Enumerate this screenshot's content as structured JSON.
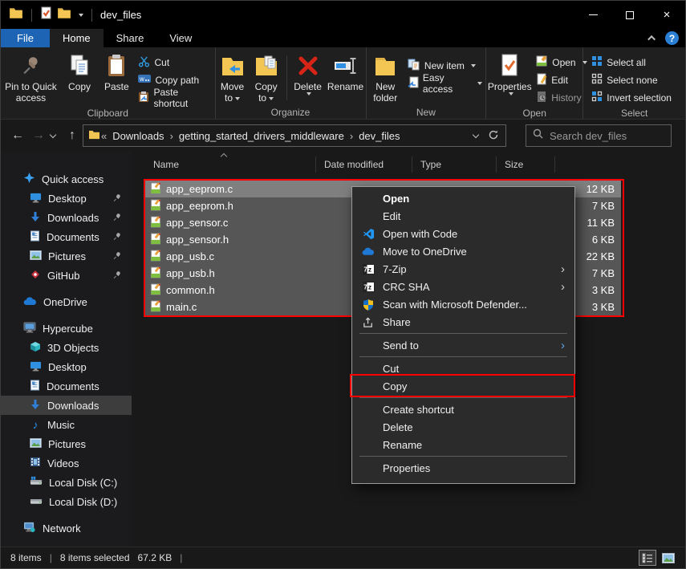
{
  "window": {
    "title": "dev_files"
  },
  "titlebar": {
    "minimize": "",
    "maximize": "",
    "close": "×",
    "help": "?"
  },
  "tabs": {
    "file": "File",
    "home": "Home",
    "share": "Share",
    "view": "View"
  },
  "ribbon": {
    "clipboard": {
      "label": "Clipboard",
      "pin_line1": "Pin to Quick",
      "pin_line2": "access",
      "copy": "Copy",
      "paste": "Paste",
      "cut": "Cut",
      "copy_path": "Copy path",
      "paste_shortcut": "Paste shortcut"
    },
    "organize": {
      "label": "Organize",
      "move_line1": "Move",
      "move_line2": "to",
      "copy_line1": "Copy",
      "copy_line2": "to",
      "delete": "Delete",
      "rename": "Rename"
    },
    "new": {
      "label": "New",
      "new_folder_line1": "New",
      "new_folder_line2": "folder",
      "new_item": "New item",
      "easy_access": "Easy access"
    },
    "open": {
      "label": "Open",
      "properties": "Properties",
      "open": "Open",
      "edit": "Edit",
      "history": "History"
    },
    "select": {
      "label": "Select",
      "select_all": "Select all",
      "select_none": "Select none",
      "invert": "Invert selection"
    }
  },
  "nav": {
    "root_collapse": "«",
    "crumb_sep": "›",
    "crumb1": "Downloads",
    "crumb2": "getting_started_drivers_middleware",
    "crumb3": "dev_files",
    "search_placeholder": "Search dev_files"
  },
  "sidebar": {
    "quick_access": "Quick access",
    "qa_items": [
      {
        "label": "Desktop"
      },
      {
        "label": "Downloads"
      },
      {
        "label": "Documents"
      },
      {
        "label": "Pictures"
      },
      {
        "label": "GitHub"
      }
    ],
    "onedrive": "OneDrive",
    "this_pc": "Hypercube",
    "pc_items": [
      {
        "label": "3D Objects"
      },
      {
        "label": "Desktop"
      },
      {
        "label": "Documents"
      },
      {
        "label": "Downloads"
      },
      {
        "label": "Music"
      },
      {
        "label": "Pictures"
      },
      {
        "label": "Videos"
      },
      {
        "label": "Local Disk (C:)"
      },
      {
        "label": "Local Disk (D:)"
      }
    ],
    "network": "Network"
  },
  "filelist": {
    "columns": {
      "name": "Name",
      "date": "Date modified",
      "type": "Type",
      "size": "Size"
    },
    "rows": [
      {
        "name": "app_eeprom.c",
        "size": "12 KB"
      },
      {
        "name": "app_eeprom.h",
        "size": "7 KB"
      },
      {
        "name": "app_sensor.c",
        "size": "11 KB"
      },
      {
        "name": "app_sensor.h",
        "size": "6 KB"
      },
      {
        "name": "app_usb.c",
        "size": "22 KB"
      },
      {
        "name": "app_usb.h",
        "size": "7 KB"
      },
      {
        "name": "common.h",
        "size": "3 KB"
      },
      {
        "name": "main.c",
        "size": "3 KB"
      }
    ]
  },
  "context_menu": {
    "items": [
      {
        "label": "Open"
      },
      {
        "label": "Edit"
      },
      {
        "label": "Open with Code"
      },
      {
        "label": "Move to OneDrive"
      },
      {
        "label": "7-Zip"
      },
      {
        "label": "CRC SHA"
      },
      {
        "label": "Scan with Microsoft Defender..."
      },
      {
        "label": "Share"
      },
      {
        "label": "Send to"
      },
      {
        "label": "Cut"
      },
      {
        "label": "Copy"
      },
      {
        "label": "Create shortcut"
      },
      {
        "label": "Delete"
      },
      {
        "label": "Rename"
      },
      {
        "label": "Properties"
      }
    ]
  },
  "statusbar": {
    "items_count": "8 items",
    "divider": "|",
    "selected": "8 items selected",
    "size": "67.2 KB"
  },
  "annotations": {
    "color": "#ff0000"
  }
}
